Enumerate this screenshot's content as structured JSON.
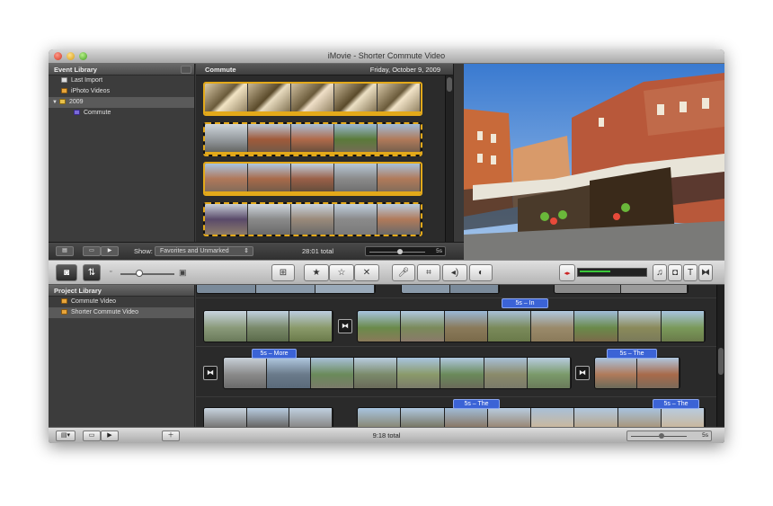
{
  "window": {
    "title": "iMovie - Shorter Commute Video"
  },
  "event_library": {
    "header": "Event Library",
    "items": [
      {
        "label": "Last Import",
        "icon": "film-icon"
      },
      {
        "label": "iPhoto Videos",
        "icon": "photo-icon"
      },
      {
        "label": "2009",
        "icon": "folder-icon",
        "expanded": true,
        "selected": true
      },
      {
        "label": "Commute",
        "icon": "event-icon"
      }
    ]
  },
  "event_browser": {
    "title": "Commute",
    "date": "Friday, October 9, 2009",
    "show_label": "Show:",
    "show_value": "Favorites and Unmarked",
    "total": "28:01 total",
    "zoom_value": "5s",
    "zoom_level": 0.55
  },
  "project_library": {
    "header": "Project Library",
    "items": [
      {
        "label": "Commute Video"
      },
      {
        "label": "Shorter Commute Video",
        "selected": true
      }
    ]
  },
  "project": {
    "title_tags": [
      "5s – In",
      "5s – More",
      "5s – The",
      "5s – The",
      "5s – The"
    ],
    "total": "9:18 total",
    "zoom_value": "5s",
    "zoom_level": 0.55
  },
  "colors": {
    "selection_border": "#e3a91a",
    "title_tag": "#3b63d6",
    "meter_green": "#3ac83a"
  }
}
